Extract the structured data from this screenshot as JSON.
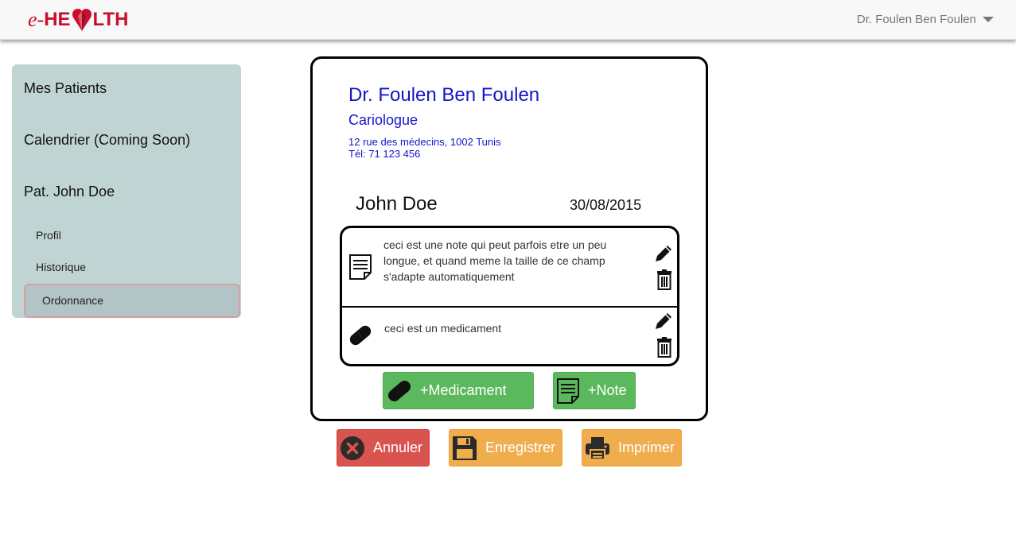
{
  "header": {
    "logo_prefix": "e-",
    "logo_left": "HE",
    "logo_right": "LTH",
    "user_name": "Dr. Foulen Ben Foulen",
    "brand_color": "#c8102e"
  },
  "sidebar": {
    "items": [
      {
        "label": "Mes Patients"
      },
      {
        "label": "Calendrier (Coming Soon)"
      },
      {
        "label": "Pat. John Doe"
      }
    ],
    "subitems": [
      {
        "label": "Profil"
      },
      {
        "label": "Historique"
      },
      {
        "label": "Ordonnance"
      }
    ]
  },
  "prescription": {
    "doctor_name": "Dr. Foulen Ben Foulen",
    "specialty": "Cariologue",
    "address": "12 rue des médecins, 1002 Tunis",
    "phone": "Tél: 71 123 456",
    "patient_name": "John Doe",
    "date": "30/08/2015",
    "entries": [
      {
        "type": "note",
        "icon": "note-icon",
        "text": "ceci est une note qui peut parfois etre un peu longue, et quand meme la taille de ce champ s'adapte automatiquement"
      },
      {
        "type": "medicament",
        "icon": "pill-icon",
        "text": "ceci est un medicament"
      }
    ],
    "add_medicament_label": "+Medicament",
    "add_note_label": "+Note"
  },
  "actions": {
    "cancel_label": "Annuler",
    "save_label": "Enregistrer",
    "print_label": "Imprimer"
  },
  "colors": {
    "accent_blue": "#1515c8",
    "green": "#5cb85c",
    "red": "#d9534f",
    "orange": "#f0ad4e",
    "sidebar_bg": "#bfd4d3"
  }
}
